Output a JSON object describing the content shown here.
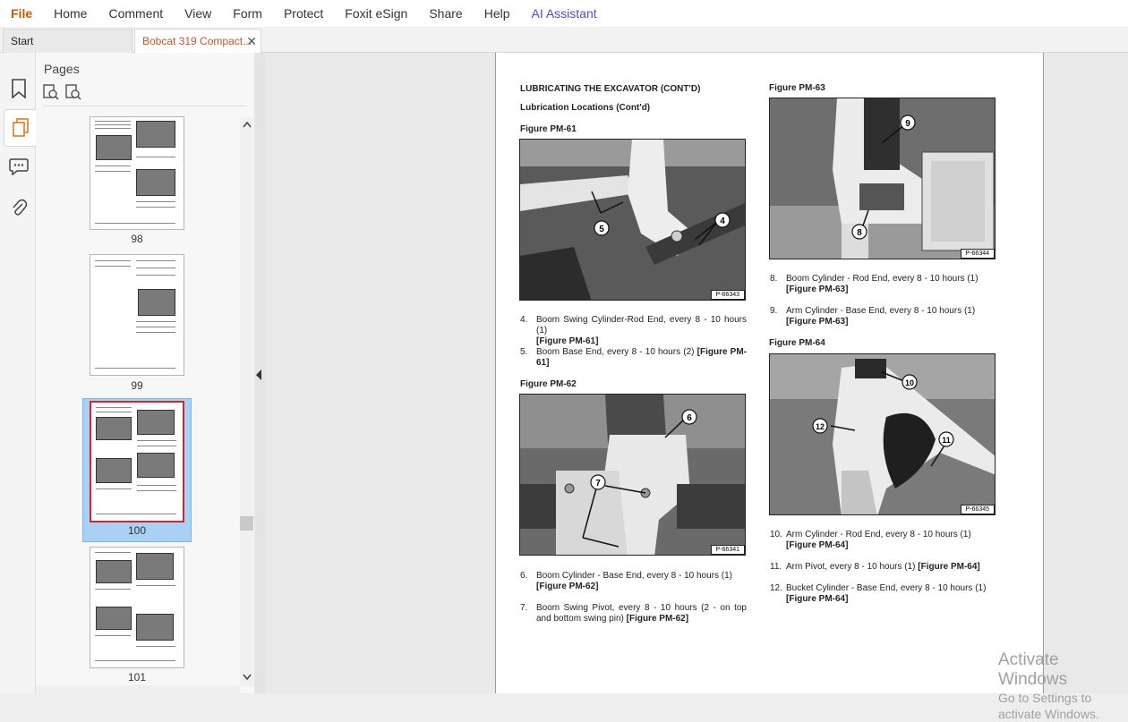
{
  "menubar": {
    "items": [
      "File",
      "Home",
      "Comment",
      "View",
      "Form",
      "Protect",
      "Foxit eSign",
      "Share",
      "Help",
      "AI Assistant"
    ]
  },
  "tabs": {
    "start": "Start",
    "doc": "Bobcat 319 Compact...",
    "close_glyph": "✕"
  },
  "pages_panel": {
    "title": "Pages",
    "thumb_labels": [
      "98",
      "99",
      "100",
      "101"
    ],
    "selected_page": "100"
  },
  "document": {
    "heading": "LUBRICATING THE EXCAVATOR (CONT'D)",
    "subheading": "Lubrication Locations (Cont'd)",
    "figures": [
      {
        "title": "Figure PM-61",
        "tag": "P-66343",
        "callouts": [
          "5",
          "4"
        ]
      },
      {
        "title": "Figure PM-62",
        "tag": "P-66341",
        "callouts": [
          "6",
          "7"
        ]
      },
      {
        "title": "Figure PM-63",
        "tag": "P-66344",
        "callouts": [
          "9",
          "8"
        ]
      },
      {
        "title": "Figure PM-64",
        "tag": "P-66345",
        "callouts": [
          "10",
          "12",
          "11"
        ]
      }
    ],
    "items_left_a": [
      {
        "num": "4.",
        "text": "Boom Swing Cylinder-Rod End, every 8 - 10 hours (1)",
        "ref": "[Figure PM-61]"
      },
      {
        "num": "5.",
        "text": "Boom Base End, every 8 - 10 hours (2)",
        "ref": "[Figure PM-61]"
      }
    ],
    "items_left_b": [
      {
        "num": "6.",
        "text": "Boom Cylinder - Base End, every 8 - 10 hours (1)",
        "ref": "[Figure PM-62]"
      },
      {
        "num": "7.",
        "text": "Boom Swing Pivot, every 8 - 10 hours (2 - on top and bottom swing pin)",
        "ref": "[Figure PM-62]"
      }
    ],
    "items_right_a": [
      {
        "num": "8.",
        "text": "Boom Cylinder - Rod End, every 8 - 10 hours (1)",
        "ref": "[Figure PM-63]"
      },
      {
        "num": "9.",
        "text": "Arm Cylinder - Base End, every 8 - 10 hours (1)",
        "ref": "[Figure PM-63]"
      }
    ],
    "items_right_b": [
      {
        "num": "10.",
        "text": "Arm Cylinder - Rod End, every 8 - 10 hours (1)",
        "ref": "[Figure PM-64]"
      },
      {
        "num": "11.",
        "text": "Arm Pivot, every 8 - 10 hours (1)",
        "ref": "[Figure PM-64]"
      },
      {
        "num": "12.",
        "text": "Bucket Cylinder - Base End, every 8 - 10 hours (1)",
        "ref": "[Figure PM-64]"
      }
    ]
  },
  "watermark": {
    "line1": "Activate Windows",
    "line2": "Go to Settings to activate Windows."
  }
}
